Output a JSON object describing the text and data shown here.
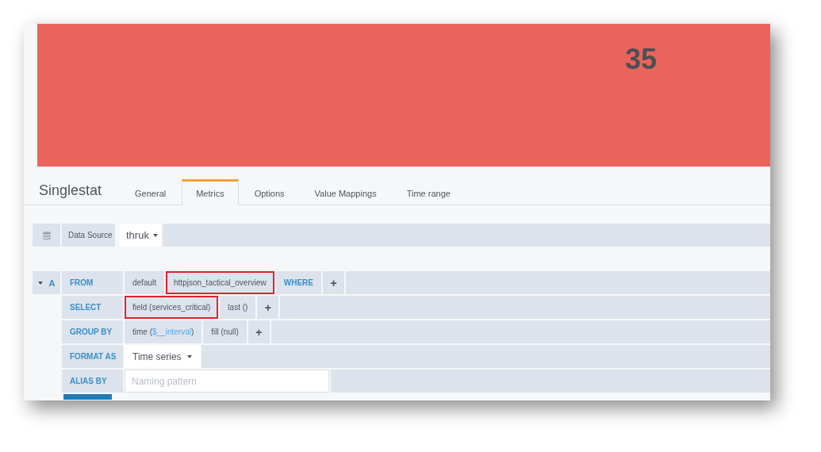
{
  "stat": {
    "value": "35",
    "color": "#ea645c"
  },
  "editor": {
    "title": "Singlestat",
    "tabs": [
      {
        "label": "General",
        "selected": false
      },
      {
        "label": "Metrics",
        "selected": true
      },
      {
        "label": "Options",
        "selected": false
      },
      {
        "label": "Value Mappings",
        "selected": false
      },
      {
        "label": "Time range",
        "selected": false
      }
    ]
  },
  "datasource": {
    "label": "Data Source",
    "value": "thruk"
  },
  "query": {
    "ref": "A",
    "rows": [
      {
        "label": "FROM",
        "segments": [
          {
            "kind": "text",
            "text": "default",
            "highlighted": false
          },
          {
            "kind": "text",
            "text": "httpjson_tactical_overview",
            "highlighted": true
          },
          {
            "kind": "keyword",
            "text": "WHERE",
            "highlighted": false
          },
          {
            "kind": "plus",
            "text": "+",
            "highlighted": false
          }
        ]
      },
      {
        "label": "SELECT",
        "segments": [
          {
            "kind": "text",
            "text": "field (services_critical)",
            "highlighted": true
          },
          {
            "kind": "text",
            "text": "last ()",
            "highlighted": false
          },
          {
            "kind": "plus",
            "text": "+",
            "highlighted": false
          }
        ]
      },
      {
        "label": "GROUP BY",
        "segments": [
          {
            "kind": "variable",
            "text": "time (",
            "variable": "$__interval",
            "suffix": ")",
            "highlighted": false
          },
          {
            "kind": "text",
            "text": "fill (null)",
            "highlighted": false
          },
          {
            "kind": "plus",
            "text": "+",
            "highlighted": false
          }
        ]
      },
      {
        "label": "FORMAT AS",
        "segments": [
          {
            "kind": "select",
            "text": "Time series",
            "highlighted": false
          }
        ]
      },
      {
        "label": "ALIAS BY",
        "segments": [
          {
            "kind": "input",
            "placeholder": "Naming pattern",
            "highlighted": false
          }
        ]
      }
    ]
  }
}
